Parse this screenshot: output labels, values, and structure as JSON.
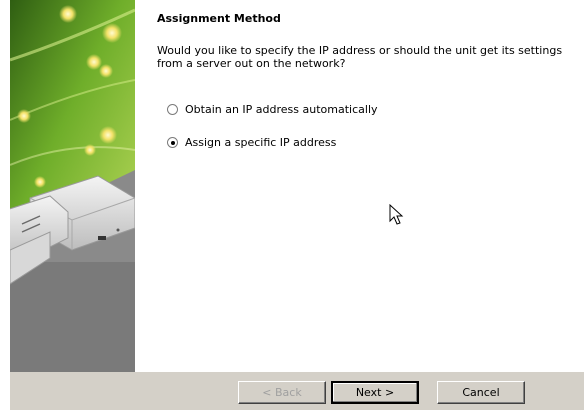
{
  "wizard": {
    "heading": "Assignment Method",
    "question": "Would you like to specify the IP address or should the unit get its settings from a server out on the network?",
    "options": [
      {
        "label": "Obtain an IP address automatically",
        "selected": false
      },
      {
        "label": "Assign a specific IP address",
        "selected": true
      }
    ],
    "buttons": {
      "back": "< Back",
      "next": "Next >",
      "cancel": "Cancel"
    }
  },
  "colors": {
    "banner_green": "#4f8f1f",
    "banner_gray": "#7a7a7a",
    "button_face": "#d4d0c8"
  }
}
